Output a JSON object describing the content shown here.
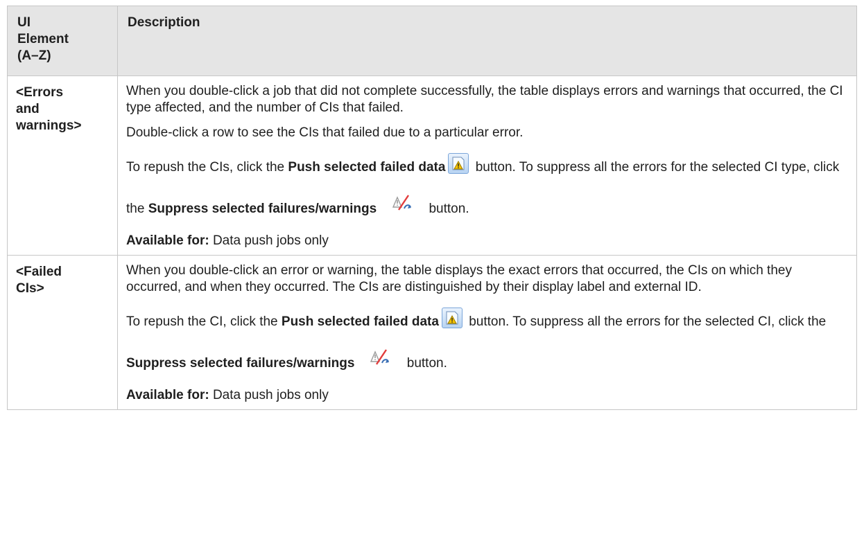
{
  "table": {
    "header": {
      "col1": [
        "UI",
        "Element",
        "(A–Z)"
      ],
      "col2": "Description"
    },
    "rows": [
      {
        "element": [
          "<Errors",
          "and",
          "warnings>"
        ],
        "p1": "When you double-click a job that did not complete successfully, the table displays errors and warnings that occurred, the CI type affected, and the number of CIs that failed.",
        "p2": "Double-click a row to see the CIs that failed due to a particular error.",
        "p3_a": "To repush the CIs, click the ",
        "p3_b": "Push selected failed data",
        "p3_c": " button. To suppress all the errors for the selected CI type, click the ",
        "p3_d": "Suppress selected failures/warnings",
        "p3_e": " button.",
        "avail_label": "Available for:",
        "avail_text": " Data push jobs only"
      },
      {
        "element": [
          "<Failed",
          "CIs>"
        ],
        "p1": "When you double-click an error or warning, the table displays the exact errors that occurred, the CIs on which they occurred, and when they occurred. The CIs are distinguished by their display label and external ID.",
        "p3_a": "To repush the CI, click the ",
        "p3_b": "Push selected failed data",
        "p3_c": " button. To suppress all the errors for the selected CI, click the ",
        "p3_d": "Suppress selected failures/warnings",
        "p3_e": " button.",
        "avail_label": "Available for:",
        "avail_text": " Data push jobs only"
      }
    ]
  },
  "icons": {
    "push": "push-selected-failed-data-icon",
    "suppress": "suppress-selected-failures-warnings-icon"
  },
  "colors": {
    "header_bg": "#e5e5e5",
    "border": "#c6c6c6"
  }
}
